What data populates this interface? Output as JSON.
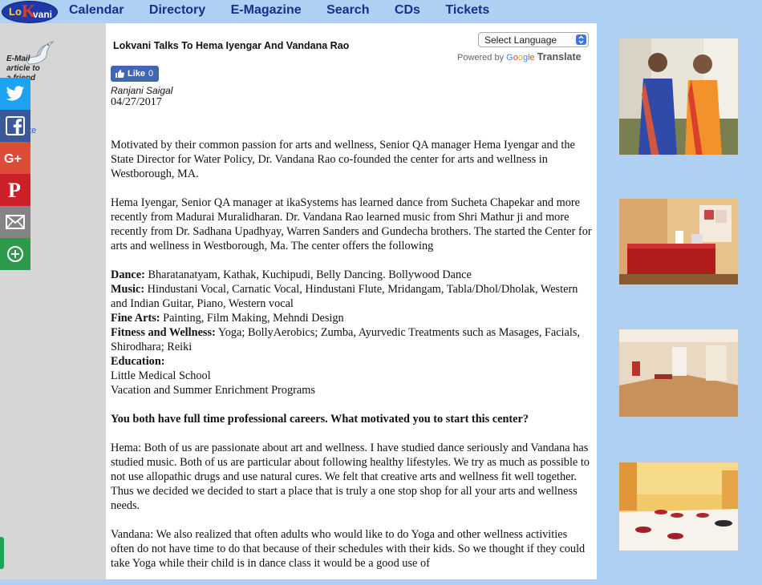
{
  "header": {
    "logo": {
      "lo": "Lo",
      "k": "K",
      "vani": "vani"
    },
    "nav": [
      "Calendar",
      "Directory",
      "E-Magazine",
      "Search",
      "CDs",
      "Tickets"
    ]
  },
  "sidebar": {
    "email_article": "E-Mail article to a friend",
    "partial_link1": "s",
    "partial_link2": "ute",
    "share_buttons": [
      {
        "name": "twitter",
        "color": "#1da1f2"
      },
      {
        "name": "facebook",
        "color": "#3b5998"
      },
      {
        "name": "google-plus",
        "color": "#dd4b39"
      },
      {
        "name": "pinterest",
        "color": "#cb2027"
      },
      {
        "name": "email",
        "color": "#848484"
      },
      {
        "name": "more",
        "color": "#2c9a4a"
      }
    ]
  },
  "article": {
    "title": "Lokvani Talks To Hema Iyengar And Vandana Rao",
    "language_select": "Select Language",
    "powered_by": "Powered by",
    "google": "Google",
    "translate": "Translate",
    "like_label": "Like",
    "like_count": "0",
    "author": "Ranjani Saigal",
    "date": "04/27/2017",
    "para1": "Motivated by their common passion for arts and wellness, Senior QA manager Hema Iyengar and the State Director for Water Policy, Dr. Vandana Rao co-founded the center for arts and wellness in Westborough, MA.",
    "para2": "Hema Iyengar, Senior QA manager at ikaSystems has learned dance from Sucheta Chapekar and more recently from Madurai Muralidharan. Dr. Vandana Rao learned music from Shri Mathur ji and more recently from Dr. Sadhana Upadhyay, Warren Sanders and Gundecha brothers.  The started the Center for arts and wellness  in Westborough, Ma. The center offers the following",
    "offer_dance_label": "Dance:",
    "offer_dance": " Bharatanatyam, Kathak, Kuchipudi, Belly Dancing. Bollywood Dance",
    "offer_music_label": "Music:",
    "offer_music": " Hindustani Vocal, Carnatic Vocal, Hindustani Flute, Mridangam, Tabla/Dhol/Dholak, Western and Indian Guitar, Piano, Western vocal",
    "offer_finearts_label": "Fine Arts:",
    "offer_finearts": " Painting, Film Making, Mehndi Design",
    "offer_fitness_label": "Fitness and Wellness:",
    "offer_fitness": " Yoga; BollyAerobics; Zumba, Ayurvedic Treatments such as Masages, Facials, Shirodhara; Reiki",
    "offer_education_label": "Education:",
    "offer_education_1": "Little Medical School",
    "offer_education_2": "Vacation and Summer Enrichment Programs",
    "question1": "You both have full time professional careers. What motivated you to start this center?",
    "answer_hema": "Hema: Both of us are passionate about art and wellness. I have studied dance seriously and Vandana has studied music. Both of us are particular about following healthy lifestyles. We try as much as possible to not use allopathic drugs and use natural cures. We felt that creative arts and wellness fit well together. Thus we decided we decided to start a place that is truly a one stop shop for all your arts and wellness needs.",
    "answer_vandana": "Vandana:  We also realized that often adults who would like to do Yoga and other wellness activities often do not have time to do that because of their schedules with their kids. So we thought if they could take Yoga while their child is in dance class it would be a good use of"
  },
  "colors": {
    "nav_bg": "#aed0f2",
    "nav_text": "#1a2d8a",
    "left_bg": "#d6d6d6",
    "facebook_like": "#4267b2"
  }
}
